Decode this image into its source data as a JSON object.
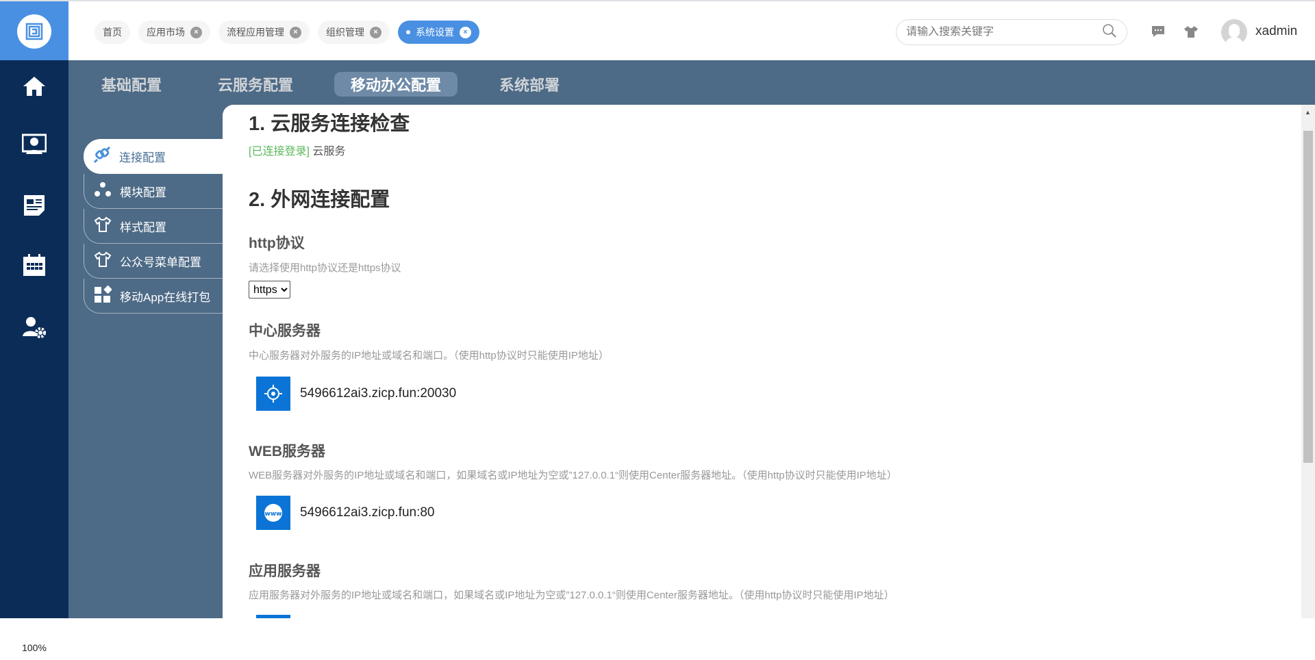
{
  "header": {
    "tabs": [
      {
        "label": "首页",
        "closable": false
      },
      {
        "label": "应用市场",
        "closable": true
      },
      {
        "label": "流程应用管理",
        "closable": true
      },
      {
        "label": "组织管理",
        "closable": true
      },
      {
        "label": "系统设置",
        "closable": true,
        "active": true
      }
    ],
    "search_placeholder": "请输入搜索关键字",
    "username": "xadmin"
  },
  "leftnav": {
    "items": [
      "home-icon",
      "monitor-user-icon",
      "news-icon",
      "calendar-icon",
      "user-settings-icon"
    ],
    "zoom": "100%"
  },
  "main_tabs": [
    {
      "label": "基础配置"
    },
    {
      "label": "云服务配置"
    },
    {
      "label": "移动办公配置",
      "active": true
    },
    {
      "label": "系统部署"
    }
  ],
  "subnav": [
    {
      "label": "连接配置",
      "icon": "plug-icon",
      "active": true
    },
    {
      "label": "模块配置",
      "icon": "modules-icon"
    },
    {
      "label": "样式配置",
      "icon": "shirt-icon"
    },
    {
      "label": "公众号菜单配置",
      "icon": "shirt-icon"
    },
    {
      "label": "移动App在线打包",
      "icon": "apps-icon"
    }
  ],
  "content": {
    "section1": {
      "title": "1. 云服务连接检查",
      "status": "[已连接登录]",
      "status_text": "云服务"
    },
    "section2": {
      "title": "2. 外网连接配置"
    },
    "http": {
      "title": "http协议",
      "desc": "请选择使用http协议还是https协议",
      "value": "https"
    },
    "center": {
      "title": "中心服务器",
      "desc": "中心服务器对外服务的IP地址或域名和端口。（使用http协议时只能使用IP地址）",
      "value": "5496612ai3.zicp.fun:20030"
    },
    "web": {
      "title": "WEB服务器",
      "desc": "WEB服务器对外服务的IP地址或域名和端口，如果域名或IP地址为空或”127.0.0.1“则使用Center服务器地址。（使用http协议时只能使用IP地址）",
      "value": "5496612ai3.zicp.fun:80"
    },
    "app": {
      "title": "应用服务器",
      "desc": "应用服务器对外服务的IP地址或域名和端口，如果域名或IP地址为空或”127.0.0.1“则使用Center服务器地址。（使用http协议时只能使用IP地址）"
    }
  },
  "colors": {
    "brand": "#4a90e2",
    "nav": "#0b2c57",
    "panel": "#4d6a86",
    "ok": "#5cb85c",
    "icon_box": "#0b74d6"
  }
}
